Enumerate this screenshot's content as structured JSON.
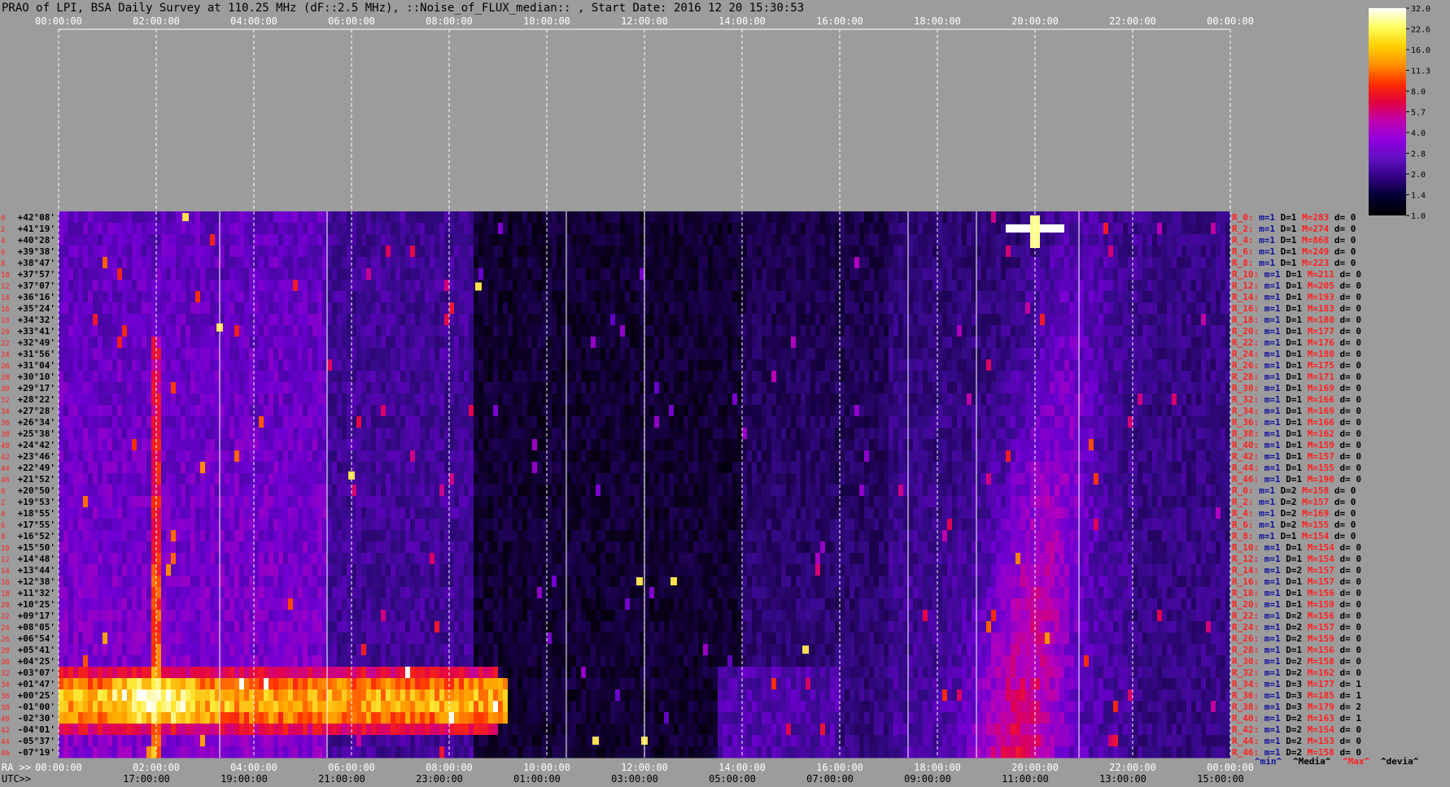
{
  "title": "PRAO of LPI, BSA Daily Survey at 110.25 MHz (dF::2.5 MHz), ::Noise_of_FLUX_median:: , Start Date: 2016 12 20 15:30:53",
  "chart_data": {
    "type": "heatmap",
    "title": "PRAO of LPI, BSA Daily Survey at 110.25 MHz (dF::2.5 MHz), ::Noise_of_FLUX_median:: , Start Date: 2016 12 20 15:30:53",
    "top_axis_labels": [
      "00:00:00",
      "02:00:00",
      "04:00:00",
      "06:00:00",
      "08:00:00",
      "10:00:00",
      "12:00:00",
      "14:00:00",
      "16:00:00",
      "18:00:00",
      "20:00:00",
      "22:00:00",
      "00:00:00"
    ],
    "ra_axis_prefix": "RA >>",
    "ra_axis_labels": [
      "00:00:00",
      "02:00:00",
      "04:00:00",
      "06:00:00",
      "08:00:00",
      "10:00:00",
      "12:00:00",
      "14:00:00",
      "16:00:00",
      "18:00:00",
      "20:00:00",
      "22:00:00",
      "00:00:00"
    ],
    "utc_axis_prefix": "UTC>>",
    "utc_axis_labels": [
      "17:00:00",
      "19:00:00",
      "21:00:00",
      "23:00:00",
      "01:00:00",
      "03:00:00",
      "05:00:00",
      "07:00:00",
      "09:00:00",
      "11:00:00",
      "13:00:00",
      "15:00:00"
    ],
    "colorbar_ticks": [
      "32.0",
      "22.6",
      "16.0",
      "11.3",
      "8.0",
      "5.7",
      "4.0",
      "2.8",
      "2.0",
      "1.4",
      "1.0"
    ],
    "colorbar_stops": [
      "#ffffff",
      "#ffff60",
      "#ffd000",
      "#ff9000",
      "#ff3000",
      "#e00040",
      "#c000b0",
      "#9000e0",
      "#6010c0",
      "#300080",
      "#000030",
      "#000000"
    ],
    "row_index_labels": [
      "0",
      "2",
      "4",
      "6",
      "8",
      "10",
      "12",
      "14",
      "16",
      "18",
      "20",
      "22",
      "24",
      "26",
      "28",
      "30",
      "32",
      "34",
      "36",
      "38",
      "40",
      "42",
      "44",
      "46",
      "0",
      "2",
      "4",
      "6",
      "8",
      "10",
      "12",
      "14",
      "16",
      "18",
      "20",
      "22",
      "24",
      "26",
      "28",
      "30",
      "32",
      "34",
      "36",
      "38",
      "40",
      "42",
      "44",
      "46"
    ],
    "declinations": [
      "+42°08'",
      "+41°19'",
      "+40°28'",
      "+39°38'",
      "+38°47'",
      "+37°57'",
      "+37°07'",
      "+36°16'",
      "+35°24'",
      "+34°32'",
      "+33°41'",
      "+32°49'",
      "+31°56'",
      "+31°04'",
      "+30°10'",
      "+29°17'",
      "+28°22'",
      "+27°28'",
      "+26°34'",
      "+25°38'",
      "+24°42'",
      "+23°46'",
      "+22°49'",
      "+21°52'",
      "+20°50'",
      "+19°53'",
      "+18°55'",
      "+17°55'",
      "+16°52'",
      "+15°50'",
      "+14°48'",
      "+13°44'",
      "+12°38'",
      "+11°32'",
      "+10°25'",
      "+09°17'",
      "+08°05'",
      "+06°54'",
      "+05°41'",
      "+04°25'",
      "+03°07'",
      "+01°47'",
      "+00°25'",
      "-01°00'",
      "-02°30'",
      "-04°01'",
      "-05°37'",
      "-07°19'"
    ],
    "row_stats": [
      {
        "ch": "R_0:",
        "m": "m=1",
        "D": "D=1",
        "M": "M=283",
        "d": "d= 0"
      },
      {
        "ch": "R_2:",
        "m": "m=1",
        "D": "D=1",
        "M": "M=274",
        "d": "d= 0"
      },
      {
        "ch": "R_4:",
        "m": "m=1",
        "D": "D=1",
        "M": "M=868",
        "d": "d= 0"
      },
      {
        "ch": "R_6:",
        "m": "m=1",
        "D": "D=1",
        "M": "M=249",
        "d": "d= 0"
      },
      {
        "ch": "R_8:",
        "m": "m=1",
        "D": "D=1",
        "M": "M=223",
        "d": "d= 0"
      },
      {
        "ch": "R_10:",
        "m": "m=1",
        "D": "D=1",
        "M": "M=211",
        "d": "d= 0"
      },
      {
        "ch": "R_12:",
        "m": "m=1",
        "D": "D=1",
        "M": "M=205",
        "d": "d= 0"
      },
      {
        "ch": "R_14:",
        "m": "m=1",
        "D": "D=1",
        "M": "M=193",
        "d": "d= 0"
      },
      {
        "ch": "R_16:",
        "m": "m=1",
        "D": "D=1",
        "M": "M=183",
        "d": "d= 0"
      },
      {
        "ch": "R_18:",
        "m": "m=1",
        "D": "D=1",
        "M": "M=180",
        "d": "d= 0"
      },
      {
        "ch": "R_20:",
        "m": "m=1",
        "D": "D=1",
        "M": "M=177",
        "d": "d= 0"
      },
      {
        "ch": "R_22:",
        "m": "m=1",
        "D": "D=1",
        "M": "M=176",
        "d": "d= 0"
      },
      {
        "ch": "R_24:",
        "m": "m=1",
        "D": "D=1",
        "M": "M=180",
        "d": "d= 0"
      },
      {
        "ch": "R_26:",
        "m": "m=1",
        "D": "D=1",
        "M": "M=175",
        "d": "d= 0"
      },
      {
        "ch": "R_28:",
        "m": "m=1",
        "D": "D=1",
        "M": "M=171",
        "d": "d= 0"
      },
      {
        "ch": "R_30:",
        "m": "m=1",
        "D": "D=1",
        "M": "M=169",
        "d": "d= 0"
      },
      {
        "ch": "R_32:",
        "m": "m=1",
        "D": "D=1",
        "M": "M=166",
        "d": "d= 0"
      },
      {
        "ch": "R_34:",
        "m": "m=1",
        "D": "D=1",
        "M": "M=169",
        "d": "d= 0"
      },
      {
        "ch": "R_36:",
        "m": "m=1",
        "D": "D=1",
        "M": "M=166",
        "d": "d= 0"
      },
      {
        "ch": "R_38:",
        "m": "m=1",
        "D": "D=1",
        "M": "M=162",
        "d": "d= 0"
      },
      {
        "ch": "R_40:",
        "m": "m=1",
        "D": "D=1",
        "M": "M=159",
        "d": "d= 0"
      },
      {
        "ch": "R_42:",
        "m": "m=1",
        "D": "D=1",
        "M": "M=157",
        "d": "d= 0"
      },
      {
        "ch": "R_44:",
        "m": "m=1",
        "D": "D=1",
        "M": "M=155",
        "d": "d= 0"
      },
      {
        "ch": "R_46:",
        "m": "m=1",
        "D": "D=1",
        "M": "M=190",
        "d": "d= 0"
      },
      {
        "ch": "R_0:",
        "m": "m=1",
        "D": "D=2",
        "M": "M=158",
        "d": "d= 0"
      },
      {
        "ch": "R_2:",
        "m": "m=1",
        "D": "D=2",
        "M": "M=157",
        "d": "d= 0"
      },
      {
        "ch": "R_4:",
        "m": "m=1",
        "D": "D=2",
        "M": "M=169",
        "d": "d= 0"
      },
      {
        "ch": "R_6:",
        "m": "m=1",
        "D": "D=2",
        "M": "M=155",
        "d": "d= 0"
      },
      {
        "ch": "R_8:",
        "m": "m=1",
        "D": "D=1",
        "M": "M=154",
        "d": "d= 0"
      },
      {
        "ch": "R_10:",
        "m": "m=1",
        "D": "D=1",
        "M": "M=154",
        "d": "d= 0"
      },
      {
        "ch": "R_12:",
        "m": "m=1",
        "D": "D=1",
        "M": "M=154",
        "d": "d= 0"
      },
      {
        "ch": "R_14:",
        "m": "m=1",
        "D": "D=2",
        "M": "M=157",
        "d": "d= 0"
      },
      {
        "ch": "R_16:",
        "m": "m=1",
        "D": "D=1",
        "M": "M=157",
        "d": "d= 0"
      },
      {
        "ch": "R_18:",
        "m": "m=1",
        "D": "D=1",
        "M": "M=156",
        "d": "d= 0"
      },
      {
        "ch": "R_20:",
        "m": "m=1",
        "D": "D=1",
        "M": "M=159",
        "d": "d= 0"
      },
      {
        "ch": "R_22:",
        "m": "m=1",
        "D": "D=2",
        "M": "M=156",
        "d": "d= 0"
      },
      {
        "ch": "R_24:",
        "m": "m=1",
        "D": "D=2",
        "M": "M=157",
        "d": "d= 0"
      },
      {
        "ch": "R_26:",
        "m": "m=1",
        "D": "D=2",
        "M": "M=159",
        "d": "d= 0"
      },
      {
        "ch": "R_28:",
        "m": "m=1",
        "D": "D=1",
        "M": "M=156",
        "d": "d= 0"
      },
      {
        "ch": "R_30:",
        "m": "m=1",
        "D": "D=2",
        "M": "M=158",
        "d": "d= 0"
      },
      {
        "ch": "R_32:",
        "m": "m=1",
        "D": "D=2",
        "M": "M=162",
        "d": "d= 0"
      },
      {
        "ch": "R_34:",
        "m": "m=1",
        "D": "D=3",
        "M": "M=177",
        "d": "d= 1"
      },
      {
        "ch": "R_36:",
        "m": "m=1",
        "D": "D=3",
        "M": "M=185",
        "d": "d= 1"
      },
      {
        "ch": "R_38:",
        "m": "m=1",
        "D": "D=3",
        "M": "M=179",
        "d": "d= 2"
      },
      {
        "ch": "R_40:",
        "m": "m=1",
        "D": "D=2",
        "M": "M=163",
        "d": "d= 1"
      },
      {
        "ch": "R_42:",
        "m": "m=1",
        "D": "D=2",
        "M": "M=154",
        "d": "d= 0"
      },
      {
        "ch": "R_44:",
        "m": "m=1",
        "D": "D=2",
        "M": "M=153",
        "d": "d= 0"
      },
      {
        "ch": "R_46:",
        "m": "m=1",
        "D": "D=2",
        "M": "M=158",
        "d": "d= 0"
      }
    ],
    "legend": [
      {
        "label": "^min^",
        "color": "#1010a0"
      },
      {
        "label": "^Media^",
        "color": "#000000"
      },
      {
        "label": "^Max^",
        "color": "#ff2020"
      },
      {
        "label": "^devia^",
        "color": "#000000"
      }
    ],
    "palette": {
      "background": "#9c9c9c",
      "row_index": "#ff2020",
      "stat_channel": "#ff2020",
      "stat_m": "#1010a0",
      "stat_D": "#000000",
      "stat_M": "#ff2020",
      "stat_d": "#000000",
      "grid": "#ffffff"
    },
    "features": {
      "bright_band_dec_range": [
        "+01°47'",
        "-02°30'"
      ],
      "bright_band_ra_range": [
        "00:00:00",
        "09:00:00"
      ],
      "bright_source_ra": "20:00:00",
      "bright_source_dec": "+41°19'",
      "diffuse_ridge_ra_range": [
        "18:30:00",
        "21:30:00"
      ]
    }
  }
}
